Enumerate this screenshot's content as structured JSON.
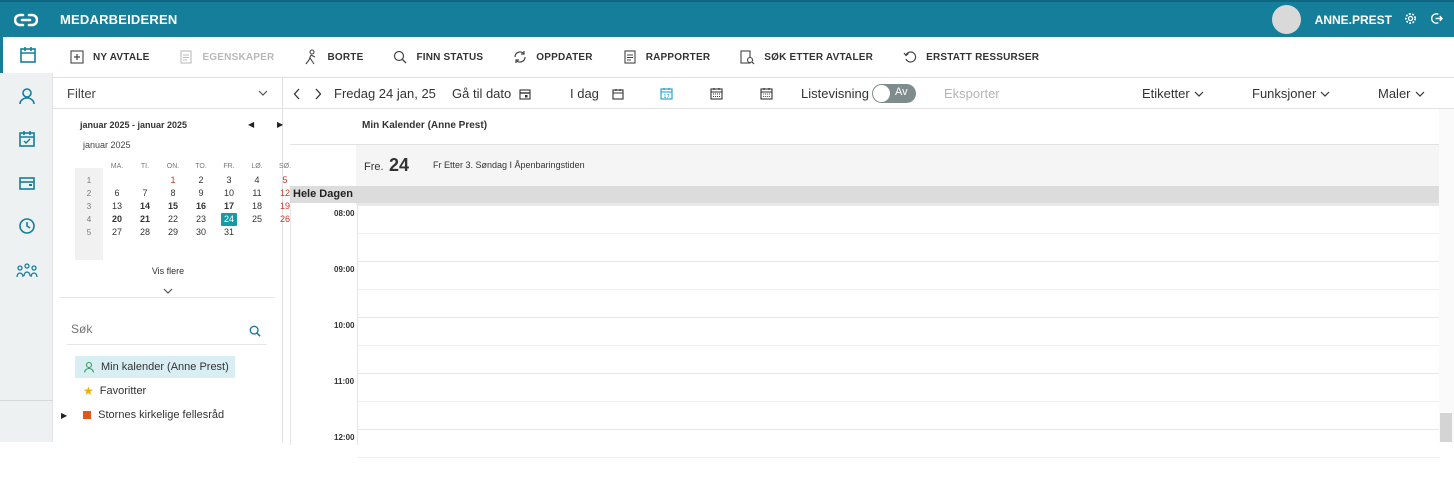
{
  "header": {
    "app_title": "MEDARBEIDEREN",
    "user_name": "ANNE.PREST"
  },
  "rail": {
    "items": [
      "calendar-icon",
      "person-icon",
      "calendar-check-icon",
      "wallet-icon",
      "clock-icon",
      "team-icon"
    ]
  },
  "toolbar": {
    "new": "NY AVTALE",
    "properties": "EGENSKAPER",
    "away": "BORTE",
    "find_status": "FINN STATUS",
    "refresh": "OPPDATER",
    "reports": "RAPPORTER",
    "search_appointments": "SØK ETTER AVTALER",
    "replace_resources": "ERSTATT RESSURSER"
  },
  "left": {
    "filter": "Filter",
    "cal_range": "januar 2025 - januar 2025",
    "cal_month": "januar 2025",
    "weekdays": [
      "MA.",
      "TI.",
      "ON.",
      "TO.",
      "FR.",
      "LØ.",
      "SØ."
    ],
    "weeks": [
      {
        "wk": "1",
        "days": [
          "",
          "",
          "1",
          "2",
          "3",
          "4",
          "5"
        ]
      },
      {
        "wk": "2",
        "days": [
          "6",
          "7",
          "8",
          "9",
          "10",
          "11",
          "12"
        ]
      },
      {
        "wk": "3",
        "days": [
          "13",
          "14",
          "15",
          "16",
          "17",
          "18",
          "19"
        ]
      },
      {
        "wk": "4",
        "days": [
          "20",
          "21",
          "22",
          "23",
          "24",
          "25",
          "26"
        ]
      },
      {
        "wk": "5",
        "days": [
          "27",
          "28",
          "29",
          "30",
          "31",
          "",
          ""
        ]
      }
    ],
    "today": "24",
    "show_more": "Vis flere",
    "search_placeholder": "Søk",
    "tree": {
      "my_calendar": "Min kalender (Anne Prest)",
      "favorites": "Favoritter",
      "org": "Stornes kirkelige fellesråd"
    }
  },
  "caltoolbar": {
    "date": "Fredag 24 jan, 25",
    "goto": "Gå til dato",
    "today": "I dag",
    "list_view": "Listevisning",
    "toggle_state": "Av",
    "export": "Eksporter",
    "labels": "Etiketter",
    "functions": "Funksjoner",
    "templates": "Maler"
  },
  "calendar": {
    "owner": "Min Kalender (Anne Prest)",
    "day_abbr": "Fre.",
    "day_num": "24",
    "day_note": "Fr Etter 3. Søndag I Åpenbaringstiden",
    "all_day": "Hele Dagen",
    "hours": [
      "08:00",
      "09:00",
      "10:00",
      "11:00",
      "12:00"
    ]
  },
  "colors": {
    "brand": "#157e9a",
    "today": "#159aa6",
    "sunday": "#c0392b"
  }
}
